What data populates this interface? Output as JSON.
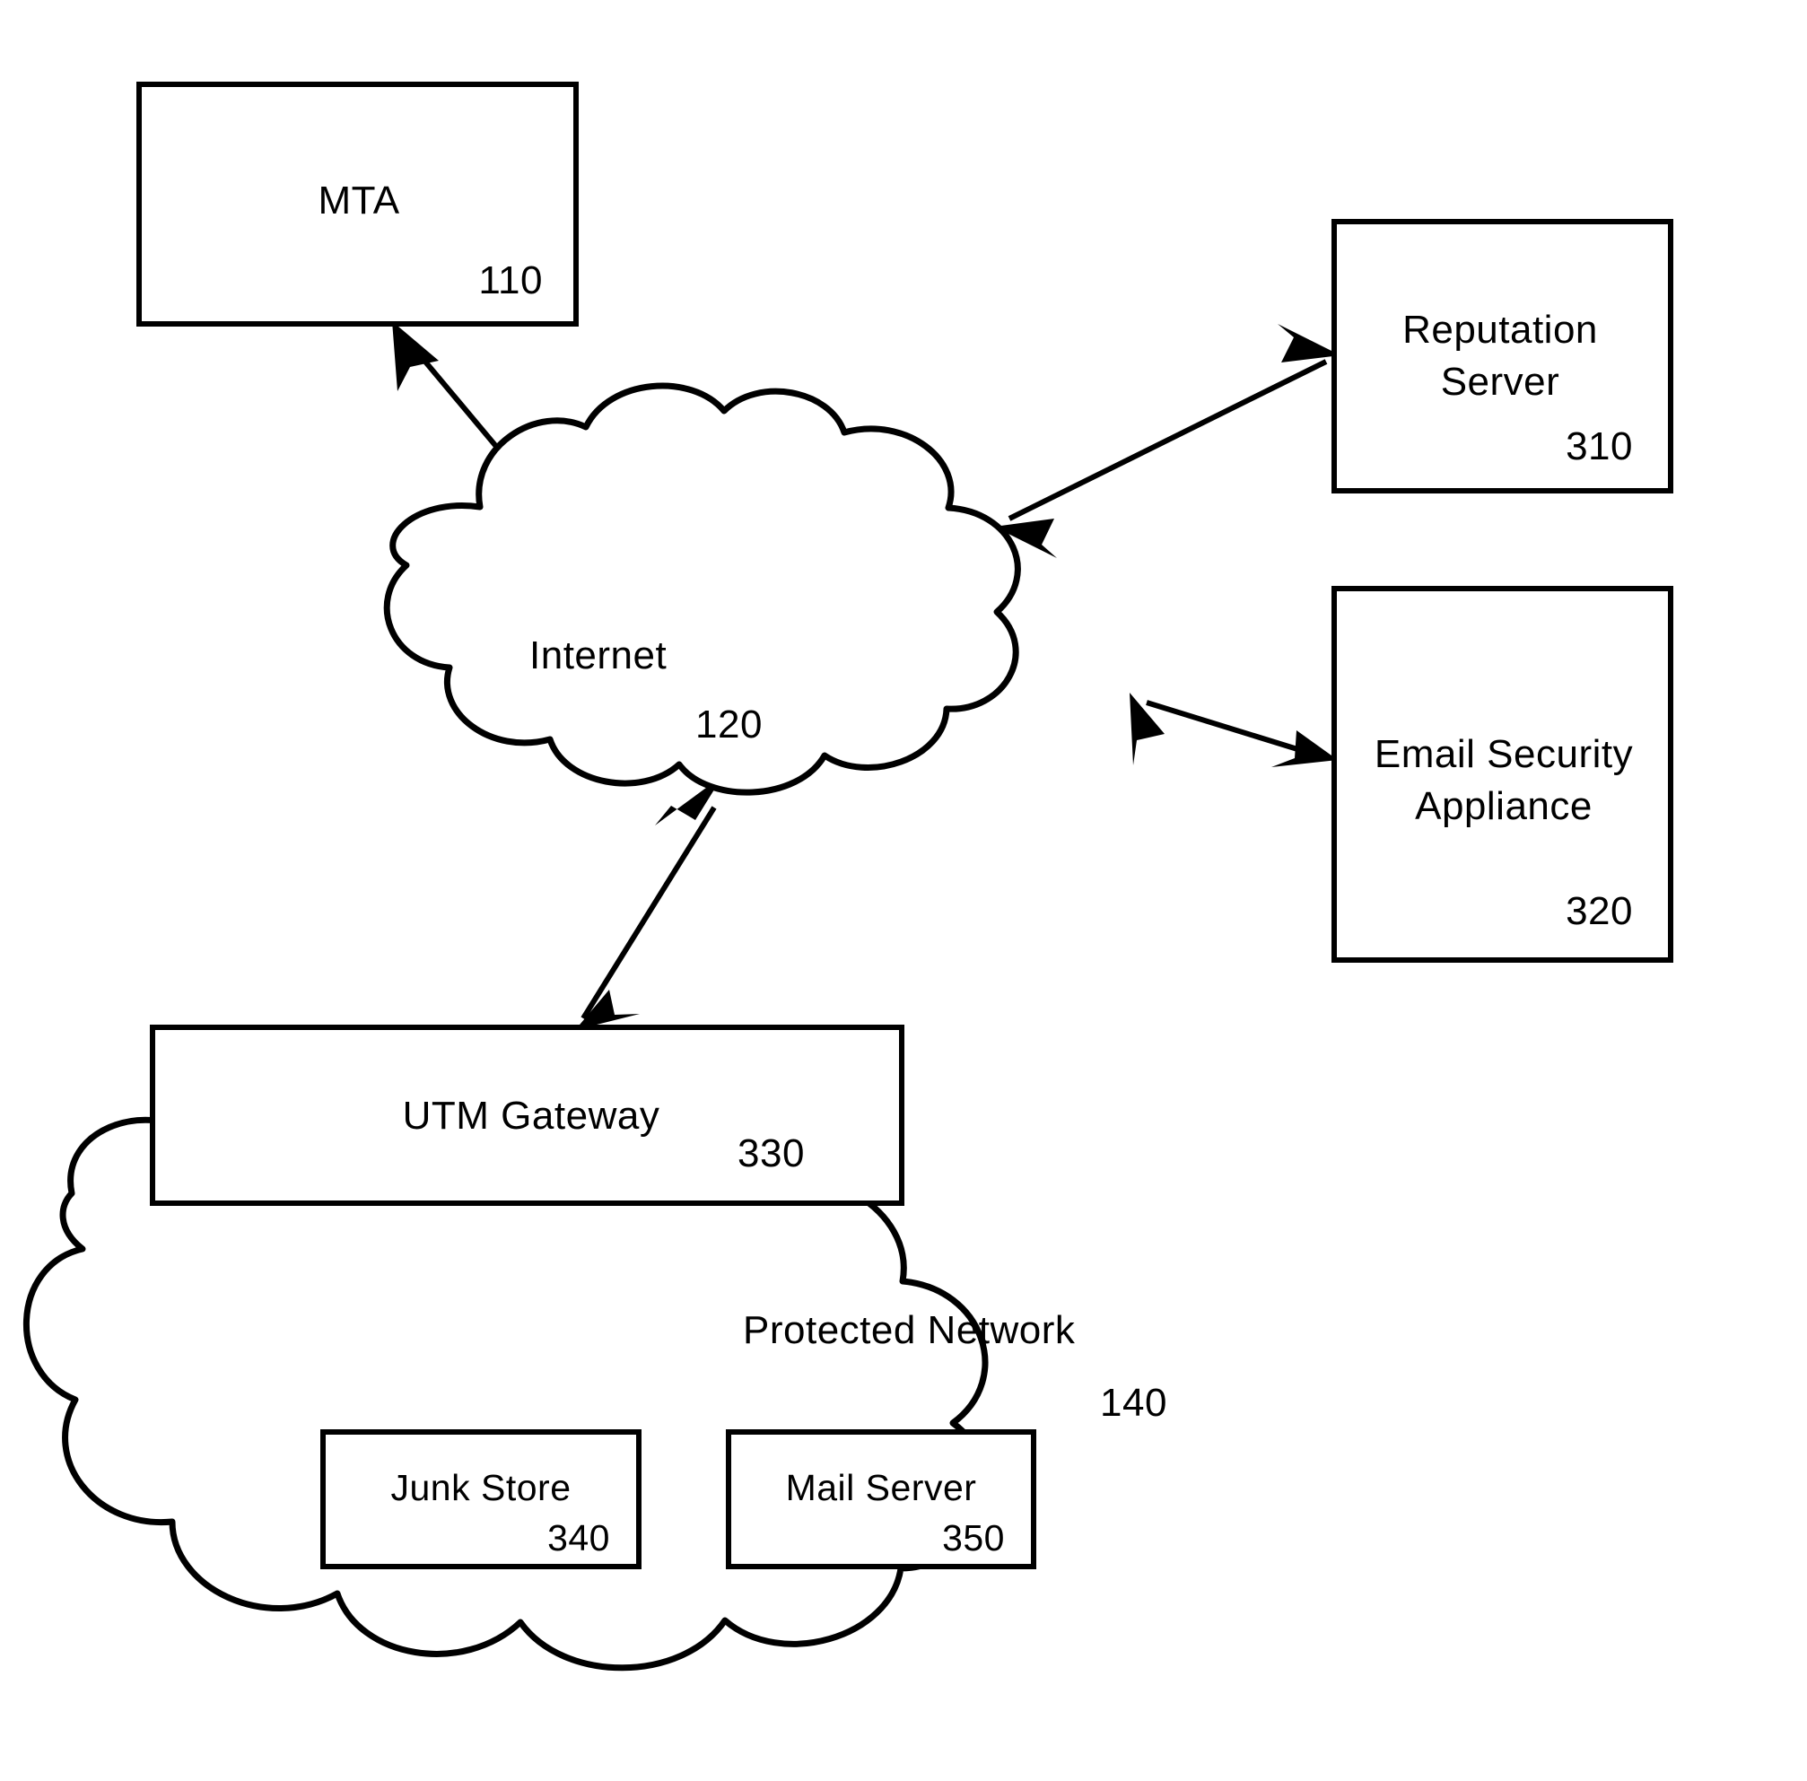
{
  "figure": {
    "type": "network-block-diagram",
    "background_color": "#ffffff",
    "line_color": "#000000"
  },
  "nodes": {
    "mta": {
      "label": "MTA",
      "ref": "110",
      "shape": "rectangle"
    },
    "internet": {
      "label": "Internet",
      "ref": "120",
      "shape": "cloud"
    },
    "reputation_server": {
      "label_line1": "Reputation",
      "label_line2": "Server",
      "ref": "310",
      "shape": "rectangle"
    },
    "email_security_appliance": {
      "label_line1": "Email Security",
      "label_line2": "Appliance",
      "ref": "320",
      "shape": "rectangle"
    },
    "utm_gateway": {
      "label": "UTM Gateway",
      "ref": "330",
      "shape": "rectangle"
    },
    "protected_network": {
      "label": "Protected Network",
      "ref": "140",
      "shape": "cloud"
    },
    "junk_store": {
      "label": "Junk Store",
      "ref": "340",
      "shape": "rectangle"
    },
    "mail_server": {
      "label": "Mail Server",
      "ref": "350",
      "shape": "rectangle"
    }
  },
  "connections": [
    {
      "from": "mta",
      "to": "internet",
      "style": "double-arrow"
    },
    {
      "from": "internet",
      "to": "reputation_server",
      "style": "double-arrow"
    },
    {
      "from": "internet",
      "to": "email_security_appliance",
      "style": "double-arrow"
    },
    {
      "from": "utm_gateway",
      "to": "internet",
      "style": "double-arrow"
    },
    {
      "from": "utm_gateway",
      "to": "junk_store",
      "style": "double-arrow"
    },
    {
      "from": "junk_store",
      "to": "mail_server",
      "style": "double-arrow"
    }
  ]
}
